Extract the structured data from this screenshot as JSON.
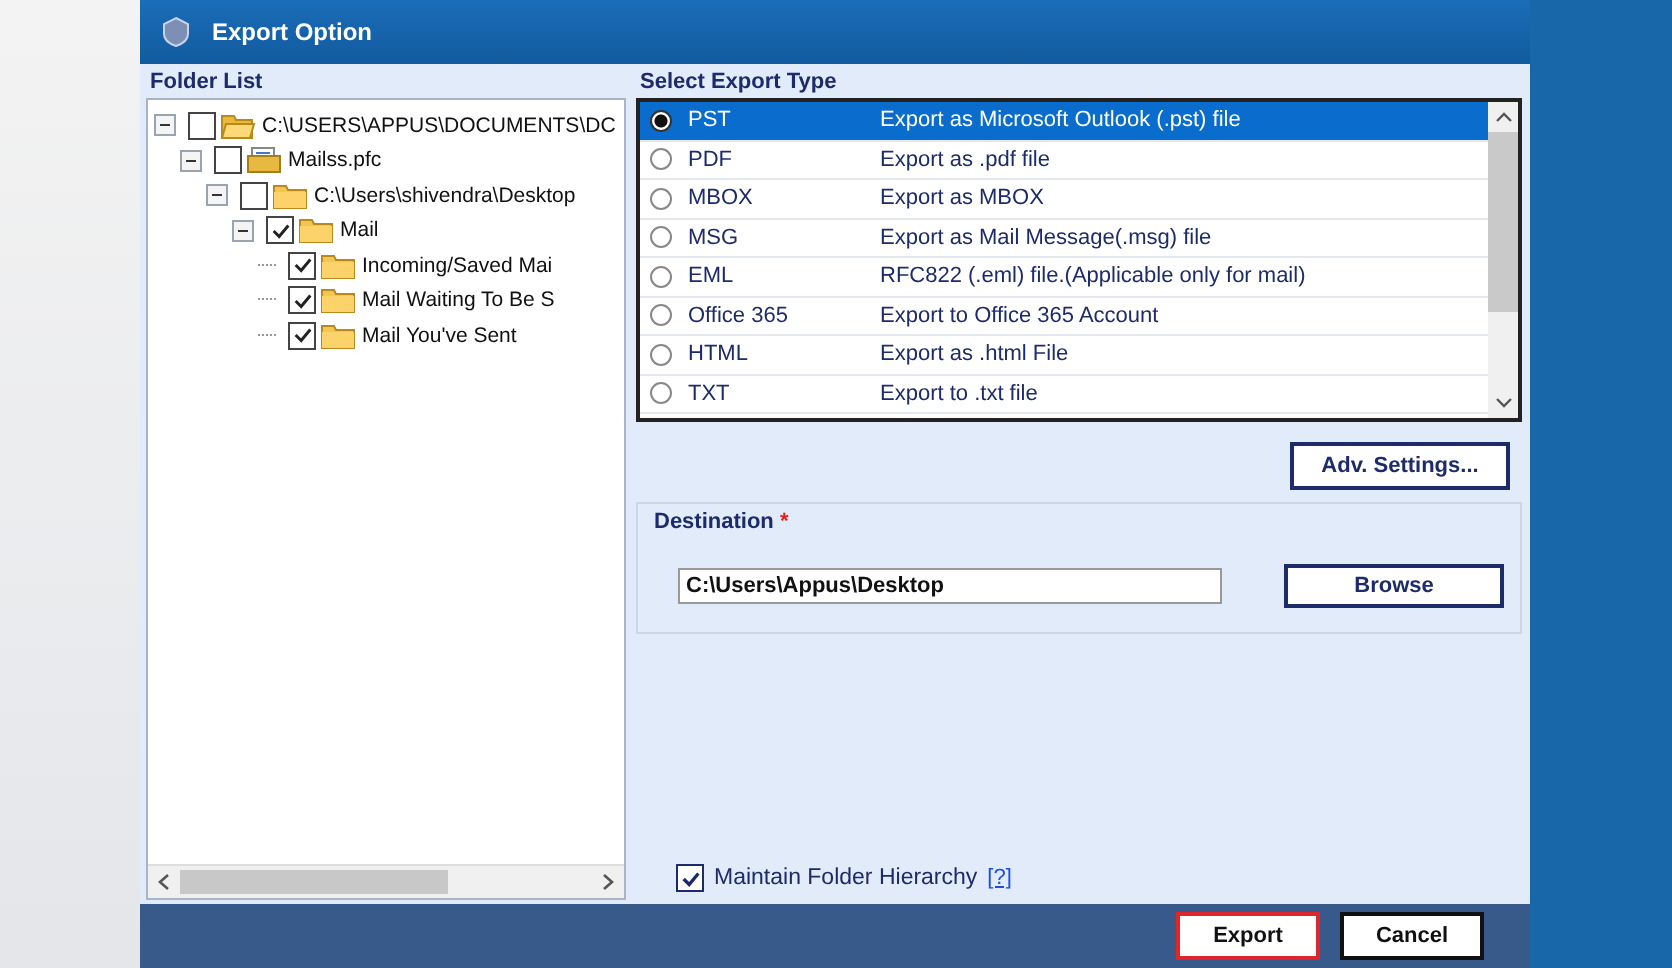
{
  "window": {
    "title": "Export Option"
  },
  "folder_list": {
    "label": "Folder List",
    "tree": [
      {
        "label": "C:\\USERS\\APPUS\\DOCUMENTS\\DC",
        "kind": "open-folder",
        "checked": false,
        "expanded": true,
        "children": [
          {
            "label": "Mailss.pfc",
            "kind": "file",
            "checked": false,
            "expanded": true,
            "children": [
              {
                "label": "C:\\Users\\shivendra\\Desktop",
                "kind": "folder",
                "checked": false,
                "expanded": true,
                "children": [
                  {
                    "label": "Mail",
                    "kind": "folder",
                    "checked": true,
                    "expanded": true,
                    "children": [
                      {
                        "label": "Incoming/Saved Mai",
                        "kind": "folder",
                        "checked": true
                      },
                      {
                        "label": "Mail Waiting To Be S",
                        "kind": "folder",
                        "checked": true
                      },
                      {
                        "label": "Mail You've Sent",
                        "kind": "folder",
                        "checked": true
                      }
                    ]
                  }
                ]
              }
            ]
          }
        ]
      }
    ]
  },
  "export_type": {
    "label": "Select Export Type",
    "options": [
      {
        "name": "PST",
        "description": "Export as Microsoft Outlook (.pst) file",
        "selected": true
      },
      {
        "name": "PDF",
        "description": "Export as .pdf file",
        "selected": false
      },
      {
        "name": "MBOX",
        "description": "Export as MBOX",
        "selected": false
      },
      {
        "name": "MSG",
        "description": "Export as Mail Message(.msg) file",
        "selected": false
      },
      {
        "name": "EML",
        "description": "RFC822 (.eml) file.(Applicable only for mail)",
        "selected": false
      },
      {
        "name": "Office 365",
        "description": "Export to Office 365 Account",
        "selected": false
      },
      {
        "name": "HTML",
        "description": "Export as .html File",
        "selected": false
      },
      {
        "name": "TXT",
        "description": "Export to .txt file",
        "selected": false
      }
    ]
  },
  "adv_settings_button": "Adv. Settings...",
  "destination": {
    "label": "Destination",
    "required_mark": "*",
    "value": "C:\\Users\\Appus\\Desktop",
    "browse_button": "Browse"
  },
  "maintain_hierarchy": {
    "label": "Maintain Folder Hierarchy",
    "help_link": "[?]",
    "checked": true
  },
  "buttons": [
    {
      "label": "Export",
      "kind": "primary"
    },
    {
      "label": "Cancel",
      "kind": "normal"
    }
  ]
}
